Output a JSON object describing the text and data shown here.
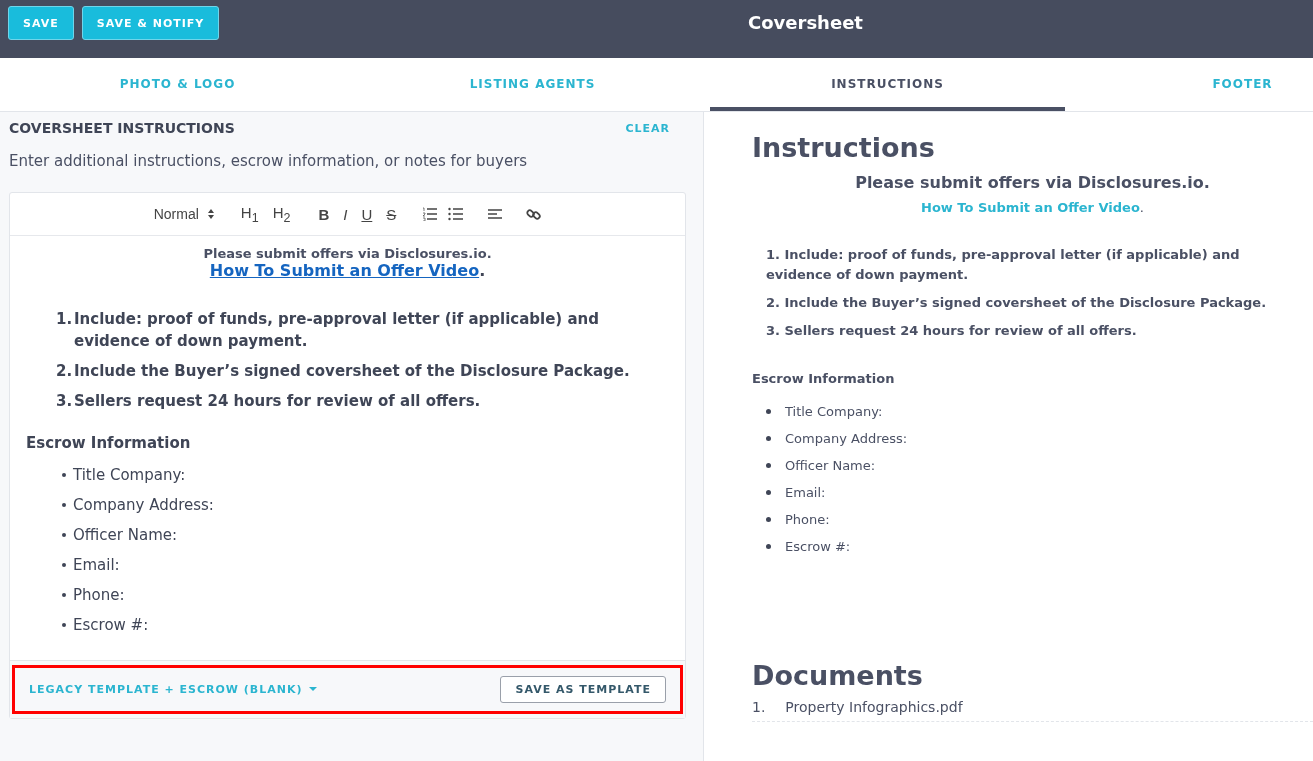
{
  "header": {
    "buttons": [
      {
        "label": "SAVE"
      },
      {
        "label": "SAVE & NOTIFY"
      }
    ],
    "title": "Coversheet"
  },
  "tabs": [
    {
      "label": "PHOTO & LOGO",
      "selected": false
    },
    {
      "label": "LISTING AGENTS",
      "selected": false
    },
    {
      "label": "INSTRUCTIONS",
      "selected": true
    },
    {
      "label": "FOOTER",
      "selected": false
    }
  ],
  "editor_panel": {
    "title": "COVERSHEET INSTRUCTIONS",
    "clear": "CLEAR",
    "description": "Enter additional instructions, escrow information, or notes for buyers",
    "toolbar": {
      "format": "Normal",
      "heading1": "H$_{1}$",
      "heading2": "H$_{2}$",
      "bold": "B",
      "italic": "I",
      "underline": "U",
      "strike": "S"
    },
    "content": {
      "intro": "Please submit offers via Disclosures.io.",
      "link": "How To Submit an Offer Video",
      "link_suffix": ".",
      "numbered": [
        {
          "number": "1.",
          "text": "Include: proof of funds, pre-approval letter (if applicable) and evidence of down payment."
        },
        {
          "number": "2.",
          "text": "Include the Buyer’s signed coversheet of the Disclosure Package."
        },
        {
          "number": "3.",
          "text": "Sellers request 24 hours for review of all offers."
        }
      ],
      "escrow_heading": "Escrow Information",
      "escrow_items": [
        "Title Company:",
        "Company Address:",
        "Officer Name:",
        "Email:",
        "Phone:",
        "Escrow #:"
      ]
    },
    "footer": {
      "template": "LEGACY TEMPLATE + ESCROW (BLANK)",
      "save_template": "SAVE AS TEMPLATE",
      "highlighted": true
    }
  },
  "preview": {
    "title": "Instructions",
    "intro": "Please submit offers via Disclosures.io.",
    "link": "How To Submit an Offer Video",
    "link_suffix": ".",
    "numbered": [
      {
        "number": "1.",
        "text": "Include: proof of funds, pre-approval letter (if applicable) and evidence of down payment."
      },
      {
        "number": "2.",
        "text": "Include the Buyer’s signed coversheet of the Disclosure Package."
      },
      {
        "number": "3.",
        "text": "Sellers request 24 hours for review of all offers."
      }
    ],
    "escrow_heading": "Escrow Information",
    "escrow_items": [
      "Title Company:",
      "Company Address:",
      "Officer Name:",
      "Email:",
      "Phone:",
      "Escrow #:"
    ],
    "documents_title": "Documents",
    "documents": [
      {
        "number": "1.",
        "name": "Property Infographics.pdf"
      }
    ]
  }
}
